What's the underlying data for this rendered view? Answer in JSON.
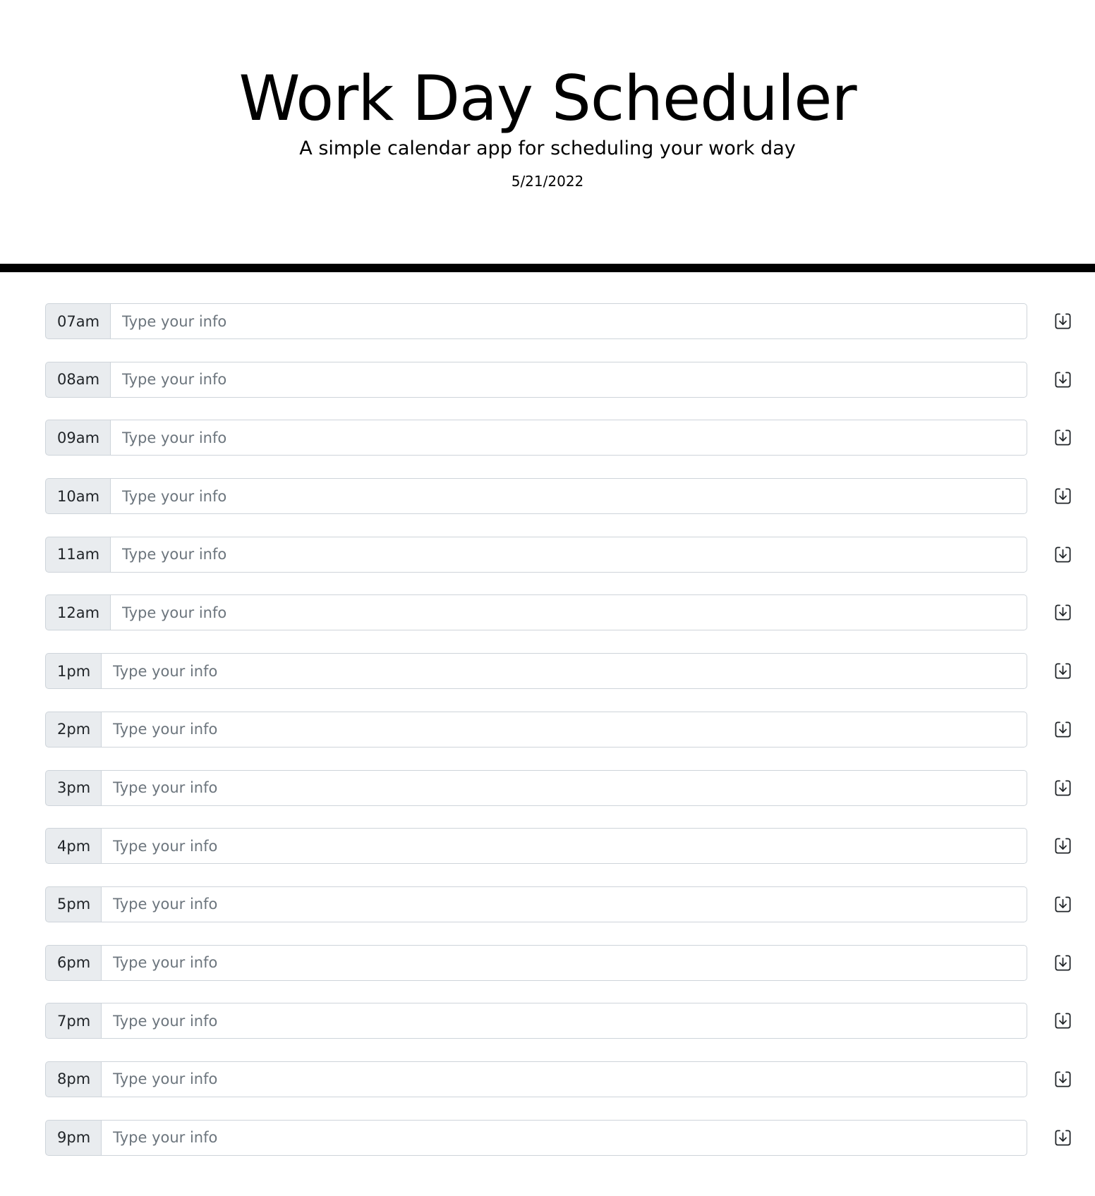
{
  "header": {
    "title": "Work Day Scheduler",
    "subtitle": "A simple calendar app for scheduling your work day",
    "date": "5/21/2022"
  },
  "rows": [
    {
      "hour": "07am",
      "placeholder": "Type your info",
      "value": ""
    },
    {
      "hour": "08am",
      "placeholder": "Type your info",
      "value": ""
    },
    {
      "hour": "09am",
      "placeholder": "Type your info",
      "value": ""
    },
    {
      "hour": "10am",
      "placeholder": "Type your info",
      "value": ""
    },
    {
      "hour": "11am",
      "placeholder": "Type your info",
      "value": ""
    },
    {
      "hour": "12am",
      "placeholder": "Type your info",
      "value": ""
    },
    {
      "hour": "1pm",
      "placeholder": "Type your info",
      "value": ""
    },
    {
      "hour": "2pm",
      "placeholder": "Type your info",
      "value": ""
    },
    {
      "hour": "3pm",
      "placeholder": "Type your info",
      "value": ""
    },
    {
      "hour": "4pm",
      "placeholder": "Type your info",
      "value": ""
    },
    {
      "hour": "5pm",
      "placeholder": "Type your info",
      "value": ""
    },
    {
      "hour": "6pm",
      "placeholder": "Type your info",
      "value": ""
    },
    {
      "hour": "7pm",
      "placeholder": "Type your info",
      "value": ""
    },
    {
      "hour": "8pm",
      "placeholder": "Type your info",
      "value": ""
    },
    {
      "hour": "9pm",
      "placeholder": "Type your info",
      "value": ""
    }
  ],
  "icons": {
    "save": "save-download-icon"
  },
  "colors": {
    "hour_background": "#e9ecef",
    "border": "#ced4da",
    "divider": "#000000",
    "placeholder": "#6c757d"
  }
}
